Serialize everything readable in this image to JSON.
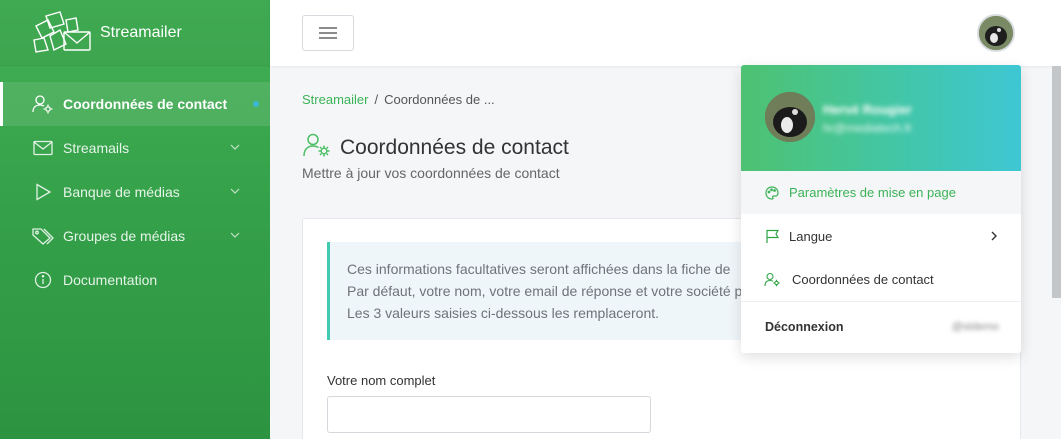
{
  "app": {
    "name": "Streamailer"
  },
  "sidebar": {
    "items": [
      {
        "label": "Coordonnées de contact",
        "icon": "user-gear-icon",
        "active": true
      },
      {
        "label": "Streamails",
        "icon": "envelope-icon",
        "has_chevron": true
      },
      {
        "label": "Banque de médias",
        "icon": "play-icon",
        "has_chevron": true
      },
      {
        "label": "Groupes de médias",
        "icon": "tags-icon",
        "has_chevron": true
      },
      {
        "label": "Documentation",
        "icon": "info-circle-icon"
      }
    ]
  },
  "header": {
    "menu_icon": "hamburger-icon",
    "avatar_icon": "user-avatar"
  },
  "breadcrumb": {
    "root": "Streamailer",
    "separator": "/",
    "current": "Coordonnées de ..."
  },
  "page": {
    "title": "Coordonnées de contact",
    "subtitle": "Mettre à jour vos coordonnées de contact"
  },
  "info": {
    "line1": "Ces informations facultatives seront affichées dans la fiche de",
    "line2": "Par défaut, votre nom, votre email de réponse et votre société p",
    "line3": "Les 3 valeurs saisies ci-dessous les remplaceront."
  },
  "form": {
    "name_label": "Votre nom complet",
    "name_value": ""
  },
  "dropdown": {
    "user_name": "Hervé Rougier",
    "user_email": "hr@mediatech.fr",
    "items": [
      {
        "label": "Paramètres de mise en page",
        "icon": "palette-icon",
        "selected": true
      },
      {
        "label": "Langue",
        "icon": "flag-icon",
        "has_arrow": true
      },
      {
        "label": "Coordonnées de contact",
        "icon": "user-gear-icon"
      }
    ],
    "logout_label": "Déconnexion",
    "logout_user": "@stdemo"
  },
  "colors": {
    "brand_green": "#3bb356",
    "sidebar_top": "#43b055",
    "accent_teal": "#42c9b2",
    "active_dot": "#39b9d3"
  }
}
